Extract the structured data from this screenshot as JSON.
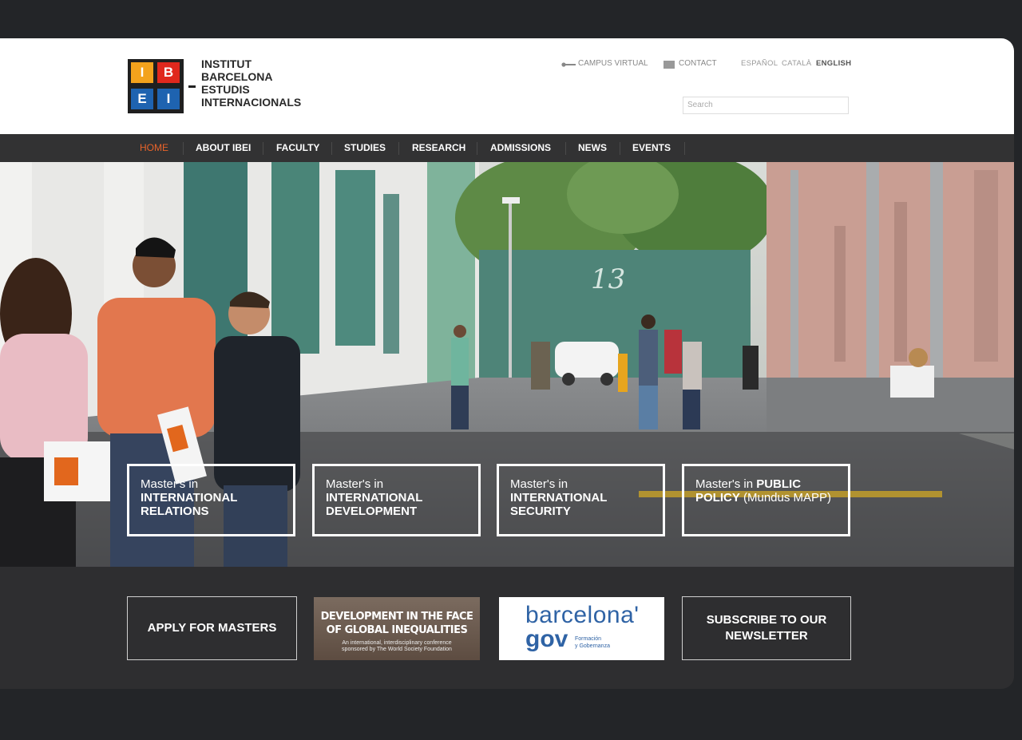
{
  "site": {
    "logo_letters": [
      "I",
      "B",
      "E",
      "I"
    ],
    "logo_colors": [
      "#f3a21c",
      "#e0281d",
      "#1e63b0",
      "#1e63b0"
    ],
    "name_lines": [
      "INSTITUT",
      "BARCELONA",
      "ESTUDIS",
      "INTERNACIONALS"
    ]
  },
  "toplinks": {
    "campus": "CAMPUS VIRTUAL",
    "contact": "CONTACT",
    "campus_icon": "key-icon",
    "contact_icon": "mail-icon"
  },
  "languages": [
    "ESPAÑOL",
    "CATALÀ",
    "ENGLISH"
  ],
  "active_language": "ENGLISH",
  "search": {
    "placeholder": "Search"
  },
  "nav": {
    "items": [
      "HOME",
      "ABOUT IBEI",
      "FACULTY",
      "STUDIES",
      "RESEARCH",
      "ADMISSIONS",
      "NEWS",
      "EVENTS"
    ],
    "active": "HOME",
    "active_color": "#e8632a"
  },
  "hero": {
    "sign_number": "13"
  },
  "masters": [
    {
      "pre": "Master's in",
      "bold": "INTERNATIONAL RELATIONS",
      "post": ""
    },
    {
      "pre": "Master's in",
      "bold": "INTERNATIONAL DEVELOPMENT",
      "post": ""
    },
    {
      "pre": "Master's in",
      "bold": "INTERNATIONAL SECURITY",
      "post": ""
    },
    {
      "pre": "Master's in ",
      "bold": "PUBLIC POLICY",
      "post": " (Mundus MAPP)"
    }
  ],
  "bottom": {
    "apply": "APPLY FOR MASTERS",
    "banner_title_1": "DEVELOPMENT IN THE FACE",
    "banner_title_2": "OF GLOBAL INEQUALITIES",
    "banner_sub_1": "An international, interdisciplinary conference",
    "banner_sub_2": "sponsored by The World Society Foundation",
    "gov_word_1": "barcelona'",
    "gov_word_2": "gov",
    "gov_sub_1": "Formación",
    "gov_sub_2": "y Gobernanza",
    "subscribe": "SUBSCRIBE TO OUR NEWSLETTER"
  }
}
